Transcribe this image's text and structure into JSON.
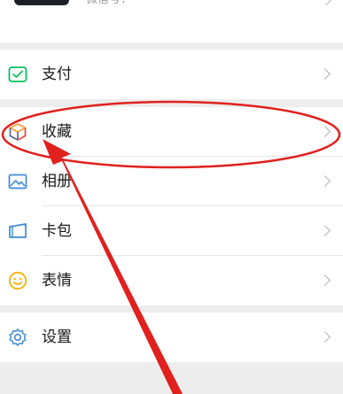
{
  "profile": {
    "wechat_id": "微信号：",
    "chevron_icon": "chevron-right-icon"
  },
  "menu_group_1": [
    {
      "label": "支付",
      "icon": "pay-icon",
      "color": "#07c160"
    }
  ],
  "menu_group_2": [
    {
      "label": "收藏",
      "icon": "favorites-cube-icon"
    },
    {
      "label": "相册",
      "icon": "album-icon"
    },
    {
      "label": "卡包",
      "icon": "card-wallet-icon"
    },
    {
      "label": "表情",
      "icon": "sticker-smile-icon"
    }
  ],
  "menu_group_3": [
    {
      "label": "设置",
      "icon": "settings-gear-icon"
    }
  ],
  "annotation": {
    "color": "#e0211e",
    "highlighted_item": "收藏"
  }
}
